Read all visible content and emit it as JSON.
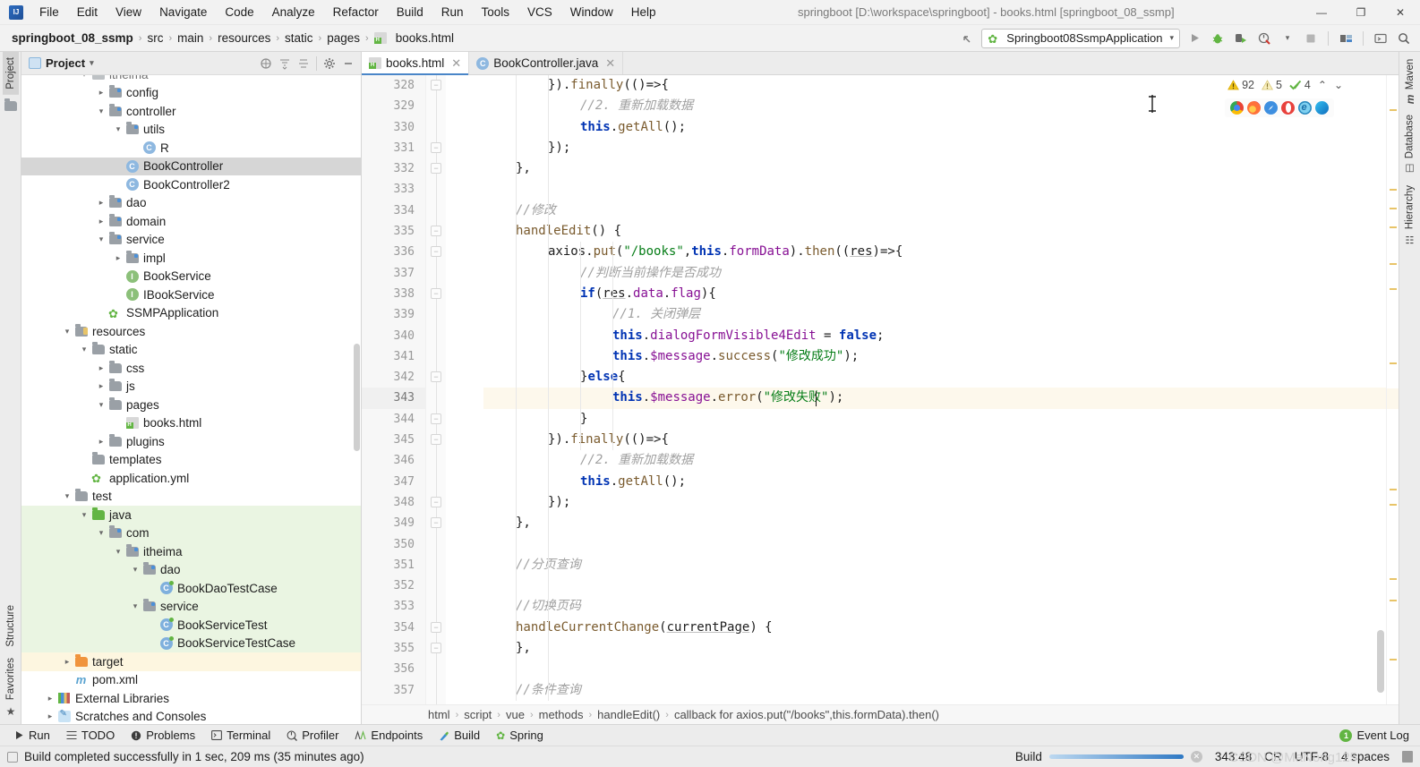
{
  "window": {
    "title": "springboot [D:\\workspace\\springboot] - books.html [springboot_08_ssmp]",
    "minimize": "—",
    "maximize": "❐",
    "close": "✕"
  },
  "menu": [
    "File",
    "Edit",
    "View",
    "Navigate",
    "Code",
    "Analyze",
    "Refactor",
    "Build",
    "Run",
    "Tools",
    "VCS",
    "Window",
    "Help"
  ],
  "navbar": {
    "crumbs": [
      "springboot_08_ssmp",
      "src",
      "main",
      "resources",
      "static",
      "pages",
      "books.html"
    ],
    "ghost_text": "",
    "run_config": "Springboot08SsmpApplication",
    "dropdown_caret": "▾"
  },
  "left_strip": {
    "tabs": [
      "Project"
    ],
    "bottom_tabs": [
      "Structure",
      "Favorites"
    ]
  },
  "right_strip": {
    "tabs": [
      "Maven",
      "Database",
      "Hierarchy"
    ]
  },
  "project_panel": {
    "title": "Project",
    "caret": "▾",
    "ghost": "",
    "tree": [
      {
        "label": "itheima",
        "depth": 3,
        "arrow": "v",
        "icon": "folder-src",
        "state": "partial"
      },
      {
        "label": "config",
        "depth": 4,
        "arrow": ">",
        "icon": "folder-src",
        "state": "normal"
      },
      {
        "label": "controller",
        "depth": 4,
        "arrow": "v",
        "icon": "folder-src",
        "state": "normal"
      },
      {
        "label": "utils",
        "depth": 5,
        "arrow": "v",
        "icon": "folder-src",
        "state": "normal"
      },
      {
        "label": "R",
        "depth": 6,
        "arrow": "",
        "icon": "class",
        "state": "normal"
      },
      {
        "label": "BookController",
        "depth": 5,
        "arrow": "",
        "icon": "class",
        "state": "selected"
      },
      {
        "label": "BookController2",
        "depth": 5,
        "arrow": "",
        "icon": "class",
        "state": "normal"
      },
      {
        "label": "dao",
        "depth": 4,
        "arrow": ">",
        "icon": "folder-src",
        "state": "normal"
      },
      {
        "label": "domain",
        "depth": 4,
        "arrow": ">",
        "icon": "folder-src",
        "state": "normal"
      },
      {
        "label": "service",
        "depth": 4,
        "arrow": "v",
        "icon": "folder-src",
        "state": "normal"
      },
      {
        "label": "impl",
        "depth": 5,
        "arrow": ">",
        "icon": "folder-src",
        "state": "normal"
      },
      {
        "label": "BookService",
        "depth": 5,
        "arrow": "",
        "icon": "interface",
        "state": "normal"
      },
      {
        "label": "IBookService",
        "depth": 5,
        "arrow": "",
        "icon": "interface",
        "state": "normal"
      },
      {
        "label": "SSMPApplication",
        "depth": 4,
        "arrow": "",
        "icon": "spring",
        "state": "normal"
      },
      {
        "label": "resources",
        "depth": 2,
        "arrow": "v",
        "icon": "folder-res",
        "state": "normal"
      },
      {
        "label": "static",
        "depth": 3,
        "arrow": "v",
        "icon": "folder",
        "state": "normal"
      },
      {
        "label": "css",
        "depth": 4,
        "arrow": ">",
        "icon": "folder",
        "state": "normal"
      },
      {
        "label": "js",
        "depth": 4,
        "arrow": ">",
        "icon": "folder",
        "state": "normal"
      },
      {
        "label": "pages",
        "depth": 4,
        "arrow": "v",
        "icon": "folder",
        "state": "normal"
      },
      {
        "label": "books.html",
        "depth": 5,
        "arrow": "",
        "icon": "html",
        "state": "normal"
      },
      {
        "label": "plugins",
        "depth": 4,
        "arrow": ">",
        "icon": "folder",
        "state": "normal"
      },
      {
        "label": "templates",
        "depth": 3,
        "arrow": "",
        "icon": "folder",
        "state": "normal"
      },
      {
        "label": "application.yml",
        "depth": 3,
        "arrow": "",
        "icon": "spring",
        "state": "normal"
      },
      {
        "label": "test",
        "depth": 2,
        "arrow": "v",
        "icon": "folder",
        "state": "normal"
      },
      {
        "label": "java",
        "depth": 3,
        "arrow": "v",
        "icon": "folder-green",
        "state": "green"
      },
      {
        "label": "com",
        "depth": 4,
        "arrow": "v",
        "icon": "folder-src",
        "state": "green"
      },
      {
        "label": "itheima",
        "depth": 5,
        "arrow": "v",
        "icon": "folder-src",
        "state": "green"
      },
      {
        "label": "dao",
        "depth": 6,
        "arrow": "v",
        "icon": "folder-src",
        "state": "green"
      },
      {
        "label": "BookDaoTestCase",
        "depth": 7,
        "arrow": "",
        "icon": "test-class",
        "state": "green"
      },
      {
        "label": "service",
        "depth": 6,
        "arrow": "v",
        "icon": "folder-src",
        "state": "green"
      },
      {
        "label": "BookServiceTest",
        "depth": 7,
        "arrow": "",
        "icon": "test-class",
        "state": "green"
      },
      {
        "label": "BookServiceTestCase",
        "depth": 7,
        "arrow": "",
        "icon": "test-class",
        "state": "green"
      },
      {
        "label": "target",
        "depth": 2,
        "arrow": ">",
        "icon": "folder-orange",
        "state": "amber"
      },
      {
        "label": "pom.xml",
        "depth": 2,
        "arrow": "",
        "icon": "maven",
        "state": "normal"
      },
      {
        "label": "External Libraries",
        "depth": 1,
        "arrow": ">",
        "icon": "libraries",
        "state": "normal"
      },
      {
        "label": "Scratches and Consoles",
        "depth": 1,
        "arrow": ">",
        "icon": "scratch",
        "state": "normal"
      }
    ]
  },
  "editor": {
    "tabs": [
      {
        "label": "books.html",
        "icon": "html-icon",
        "active": true,
        "close": "✕"
      },
      {
        "label": "BookController.java",
        "icon": "class-icon",
        "active": false,
        "close": "✕"
      }
    ],
    "inspections": {
      "warnings": "92",
      "weak_warnings": "5",
      "checks": "4",
      "up": "⌃",
      "down": "⌄"
    },
    "browsers": [
      "chrome-icon",
      "firefox-icon",
      "safari-icon",
      "opera-icon",
      "ie-icon",
      "edge-icon"
    ],
    "first_line": 328,
    "lines": [
      {
        "n": 328,
        "indent": 8,
        "tokens": [
          {
            "t": "}).",
            "c": "id"
          },
          {
            "t": "finally",
            "c": "fn"
          },
          {
            "t": "((()=>{",
            "c": "id"
          }
        ],
        "raw": "}).finally(()=>{"
      },
      {
        "n": 329,
        "indent": 12,
        "tokens": [],
        "raw": "//2. 重新加载数据",
        "comment": true
      },
      {
        "n": 330,
        "indent": 12,
        "tokens": [],
        "raw": "this.getAll();"
      },
      {
        "n": 331,
        "indent": 8,
        "tokens": [],
        "raw": "});"
      },
      {
        "n": 332,
        "indent": 4,
        "tokens": [],
        "raw": "},"
      },
      {
        "n": 333,
        "indent": 0,
        "tokens": [],
        "raw": ""
      },
      {
        "n": 334,
        "indent": 4,
        "tokens": [],
        "raw": "//修改",
        "comment": true
      },
      {
        "n": 335,
        "indent": 4,
        "tokens": [],
        "raw": "handleEdit() {"
      },
      {
        "n": 336,
        "indent": 8,
        "tokens": [],
        "raw": "axios.put(\"/books\",this.formData).then((res)=>{"
      },
      {
        "n": 337,
        "indent": 12,
        "tokens": [],
        "raw": "//判断当前操作是否成功",
        "comment": true
      },
      {
        "n": 338,
        "indent": 12,
        "tokens": [],
        "raw": "if(res.data.flag){"
      },
      {
        "n": 339,
        "indent": 16,
        "tokens": [],
        "raw": "//1. 关闭弹层",
        "comment": true
      },
      {
        "n": 340,
        "indent": 16,
        "tokens": [],
        "raw": "this.dialogFormVisible4Edit = false;"
      },
      {
        "n": 341,
        "indent": 16,
        "tokens": [],
        "raw": "this.$message.success(\"修改成功\");"
      },
      {
        "n": 342,
        "indent": 12,
        "tokens": [],
        "raw": "}else{"
      },
      {
        "n": 343,
        "indent": 16,
        "tokens": [],
        "raw": "this.$message.error(\"修改失败\");",
        "highlight": true
      },
      {
        "n": 344,
        "indent": 12,
        "tokens": [],
        "raw": "}"
      },
      {
        "n": 345,
        "indent": 8,
        "tokens": [],
        "raw": "}).finally(()=>{"
      },
      {
        "n": 346,
        "indent": 12,
        "tokens": [],
        "raw": "//2. 重新加载数据",
        "comment": true
      },
      {
        "n": 347,
        "indent": 12,
        "tokens": [],
        "raw": "this.getAll();"
      },
      {
        "n": 348,
        "indent": 8,
        "tokens": [],
        "raw": "});"
      },
      {
        "n": 349,
        "indent": 4,
        "tokens": [],
        "raw": "},"
      },
      {
        "n": 350,
        "indent": 0,
        "tokens": [],
        "raw": ""
      },
      {
        "n": 351,
        "indent": 4,
        "tokens": [],
        "raw": "//分页查询",
        "comment": true
      },
      {
        "n": 352,
        "indent": 0,
        "tokens": [],
        "raw": ""
      },
      {
        "n": 353,
        "indent": 4,
        "tokens": [],
        "raw": "//切换页码",
        "comment": true
      },
      {
        "n": 354,
        "indent": 4,
        "tokens": [],
        "raw": "handleCurrentChange(currentPage) {"
      },
      {
        "n": 355,
        "indent": 4,
        "tokens": [],
        "raw": "},"
      },
      {
        "n": 356,
        "indent": 0,
        "tokens": [],
        "raw": ""
      },
      {
        "n": 357,
        "indent": 4,
        "tokens": [],
        "raw": "//条件查询",
        "comment": true
      }
    ],
    "code_breadcrumbs": [
      "html",
      "script",
      "vue",
      "methods",
      "handleEdit()",
      "callback for axios.put(\"/books\",this.formData).then()"
    ],
    "breadcrumb_sep": "›"
  },
  "bottom_bar": {
    "tabs": [
      {
        "label": "Run",
        "icon": "run-icon"
      },
      {
        "label": "TODO",
        "icon": "todo-icon"
      },
      {
        "label": "Problems",
        "icon": "problems-icon"
      },
      {
        "label": "Terminal",
        "icon": "terminal-icon"
      },
      {
        "label": "Profiler",
        "icon": "profiler-icon"
      },
      {
        "label": "Endpoints",
        "icon": "endpoints-icon"
      },
      {
        "label": "Build",
        "icon": "build-icon"
      },
      {
        "label": "Spring",
        "icon": "spring-icon"
      }
    ],
    "event_log": {
      "label": "Event Log",
      "count": "1"
    }
  },
  "status_bar": {
    "message": "Build completed successfully in 1 sec, 209 ms (35 minutes ago)",
    "build_label": "Build",
    "caret_position": "343:48",
    "line_separator": "CR",
    "encoding": "UTF-8",
    "indent": "4 spaces",
    "watermark": "CSDN @MaNong125"
  },
  "colors": {
    "accent_blue": "#4a86c8",
    "keyword": "#0033b3",
    "string": "#067d17",
    "comment": "#a0a0a0",
    "property": "#871094",
    "function": "#7a5b2e",
    "warning_yellow": "#e8c468",
    "green": "#62b543"
  }
}
